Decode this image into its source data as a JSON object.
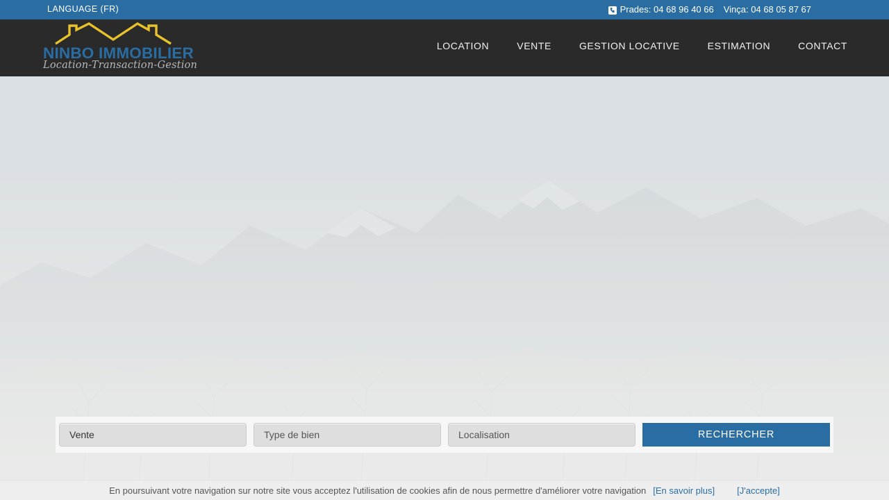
{
  "topbar": {
    "language_label": "LANGUAGE (FR)",
    "phone_icon": "phone-icon",
    "phone_prades": "Prades: 04 68 96 40 66",
    "phone_vinca": "Vinça: 04 68 05 87 67",
    "background_color": "#2a6da3"
  },
  "header": {
    "background_color": "#2a2a2a",
    "logo": {
      "name": "NINBO IMMOBILIER",
      "tagline": "Location-Transaction-Gestion",
      "roof_icon": "house-roofline-icon",
      "name_color": "#2a6da3",
      "roof_color": "#e8c22a"
    },
    "nav": [
      {
        "label": "LOCATION"
      },
      {
        "label": "VENTE"
      },
      {
        "label": "GESTION LOCATIVE"
      },
      {
        "label": "ESTIMATION"
      },
      {
        "label": "CONTACT"
      }
    ]
  },
  "hero": {
    "background_description": "faded mountain landscape photo"
  },
  "search": {
    "transaction_type_value": "Vente",
    "property_type_placeholder": "Type de bien",
    "location_placeholder": "Localisation",
    "submit_label": "RECHERCHER",
    "button_color": "#2a6da3"
  },
  "cookies": {
    "message": "En poursuivant votre navigation sur notre site vous acceptez l'utilisation de cookies afin de nous permettre d'améliorer votre navigation",
    "learn_more_label": "[En savoir plus]",
    "accept_label": "[J'accepte]",
    "link_color": "#2a6da3"
  }
}
